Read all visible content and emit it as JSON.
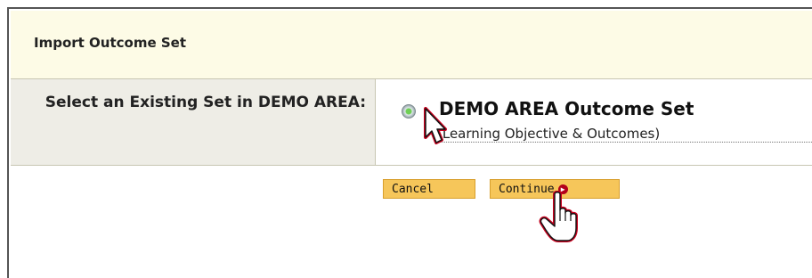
{
  "header": {
    "title": "Import Outcome Set"
  },
  "selection": {
    "label": "Select an Existing Set in DEMO AREA:",
    "option_name": "DEMO AREA Outcome Set",
    "option_subtitle": "(Learning Objective & Outcomes)",
    "option_selected": true
  },
  "actions": {
    "cancel_label": "Cancel",
    "continue_label": "Continue",
    "continue_icon": "arrow-right-circle-icon"
  },
  "colors": {
    "header_bg": "#fdfbe6",
    "label_bg": "#eeede6",
    "button_bg": "#f6c65a",
    "accent_red": "#b3001b"
  }
}
